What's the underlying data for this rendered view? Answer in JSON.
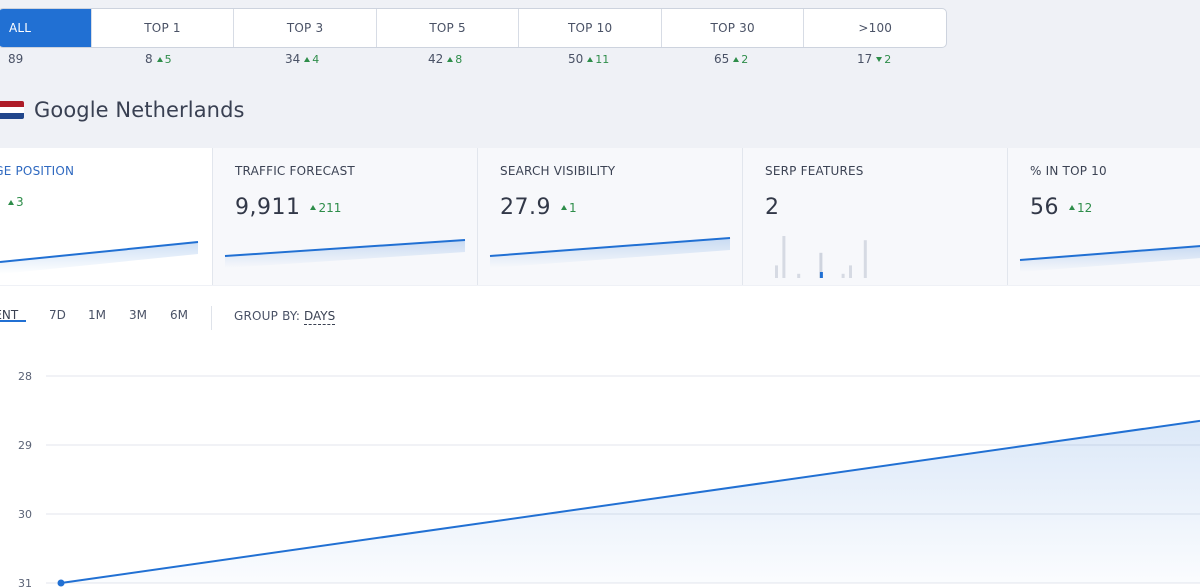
{
  "segments": {
    "tabs": [
      {
        "label": "ALL",
        "count": "89",
        "delta": "",
        "dir": ""
      },
      {
        "label": "TOP 1",
        "count": "8",
        "delta": "5",
        "dir": "up"
      },
      {
        "label": "TOP 3",
        "count": "34",
        "delta": "4",
        "dir": "up"
      },
      {
        "label": "TOP 5",
        "count": "42",
        "delta": "8",
        "dir": "up"
      },
      {
        "label": "TOP 10",
        "count": "50",
        "delta": "11",
        "dir": "up"
      },
      {
        "label": "TOP 30",
        "count": "65",
        "delta": "2",
        "dir": "up"
      },
      {
        "label": ">100",
        "count": "17",
        "delta": "2",
        "dir": "down"
      }
    ]
  },
  "engine": {
    "title": "Google Netherlands",
    "flag_colors": [
      "#ae1c28",
      "#ffffff",
      "#21468b"
    ]
  },
  "metrics": [
    {
      "label": "AGE POSITION",
      "value": "",
      "delta": "3",
      "dir": "up",
      "chart": "line"
    },
    {
      "label": "TRAFFIC FORECAST",
      "value": "9,911",
      "delta": "211",
      "dir": "up",
      "chart": "line"
    },
    {
      "label": "SEARCH VISIBILITY",
      "value": "27.9",
      "delta": "1",
      "dir": "up",
      "chart": "line"
    },
    {
      "label": "SERP FEATURES",
      "value": "2",
      "delta": "",
      "dir": "",
      "chart": "bars"
    },
    {
      "label": "% IN TOP 10",
      "value": "56",
      "delta": "12",
      "dir": "up",
      "chart": "line"
    }
  ],
  "range": {
    "tabs": [
      "RENT",
      "7D",
      "1M",
      "3M",
      "6M"
    ],
    "active": "RENT",
    "group_by_label": "GROUP BY:",
    "group_by_value": "DAYS"
  },
  "colors": {
    "accent": "#2170d3",
    "positive": "#2e8d4a",
    "grid": "#e3e6ec"
  },
  "chart_data": {
    "type": "line",
    "title": "",
    "xlabel": "",
    "ylabel": "",
    "y_reversed": true,
    "yticks": [
      "28",
      "29",
      "30",
      "31"
    ],
    "ylim": [
      31,
      28
    ],
    "x": [
      0,
      1
    ],
    "series": [
      {
        "values": [
          31.0,
          28.65
        ]
      }
    ],
    "grid": true
  },
  "serp_bars": [
    3,
    10,
    0,
    1,
    0,
    0,
    6,
    0,
    0,
    1,
    3,
    0,
    9
  ],
  "serp_highlight_index": 6
}
